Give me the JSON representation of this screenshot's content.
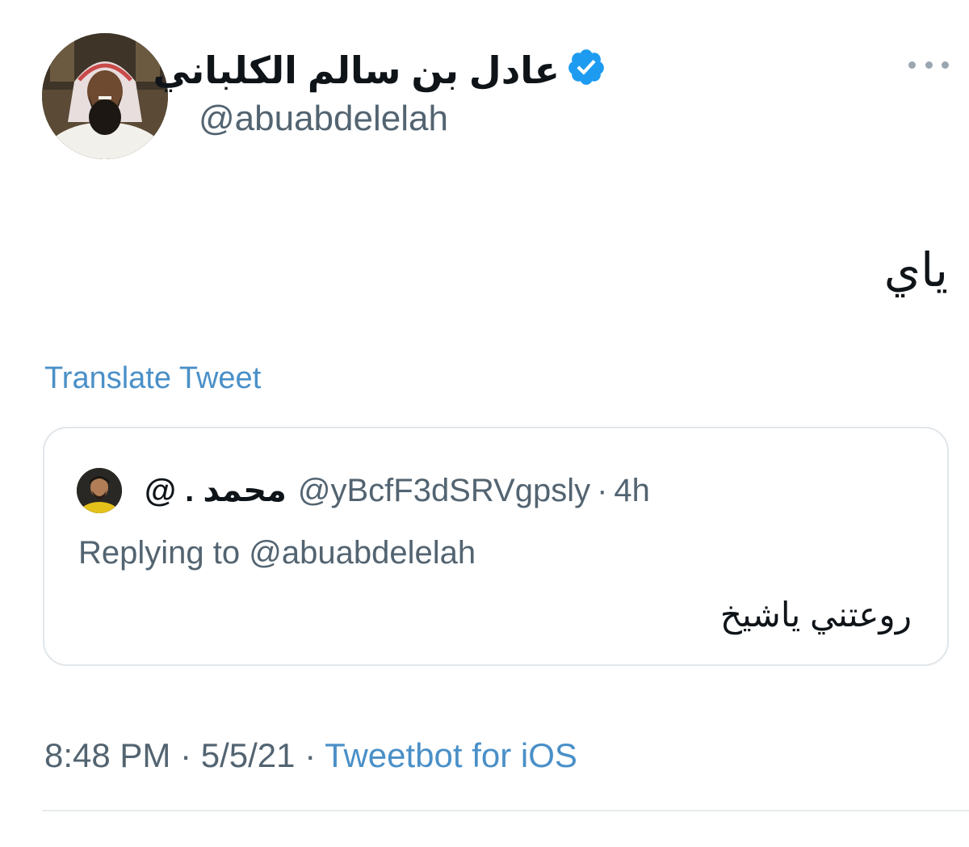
{
  "tweet": {
    "author": {
      "display_name": "عادل بن سالم الكلباني",
      "handle": "@abuabdelelah",
      "verified": true,
      "avatar_icon": "profile-photo-icon"
    },
    "more_icon": "more-options-icon",
    "text": "ياي",
    "translate_label": "Translate Tweet",
    "quoted": {
      "display_name": "محمد . @",
      "handle": "@yBcfF3dSRVgpsly",
      "separator": "·",
      "time_ago": "4h",
      "replying_prefix": "Replying to ",
      "replying_mention": "@abuabdelelah",
      "text": "روعتني ياشيخ"
    },
    "meta": {
      "time": "8:48 PM",
      "sep1": " · ",
      "date": "5/5/21",
      "sep2": " · ",
      "source": "Tweetbot for iOS"
    }
  },
  "colors": {
    "link": "#4a90c8",
    "verified": "#1d9bf0",
    "secondary_text": "#536471",
    "border": "#e1e6ea"
  }
}
